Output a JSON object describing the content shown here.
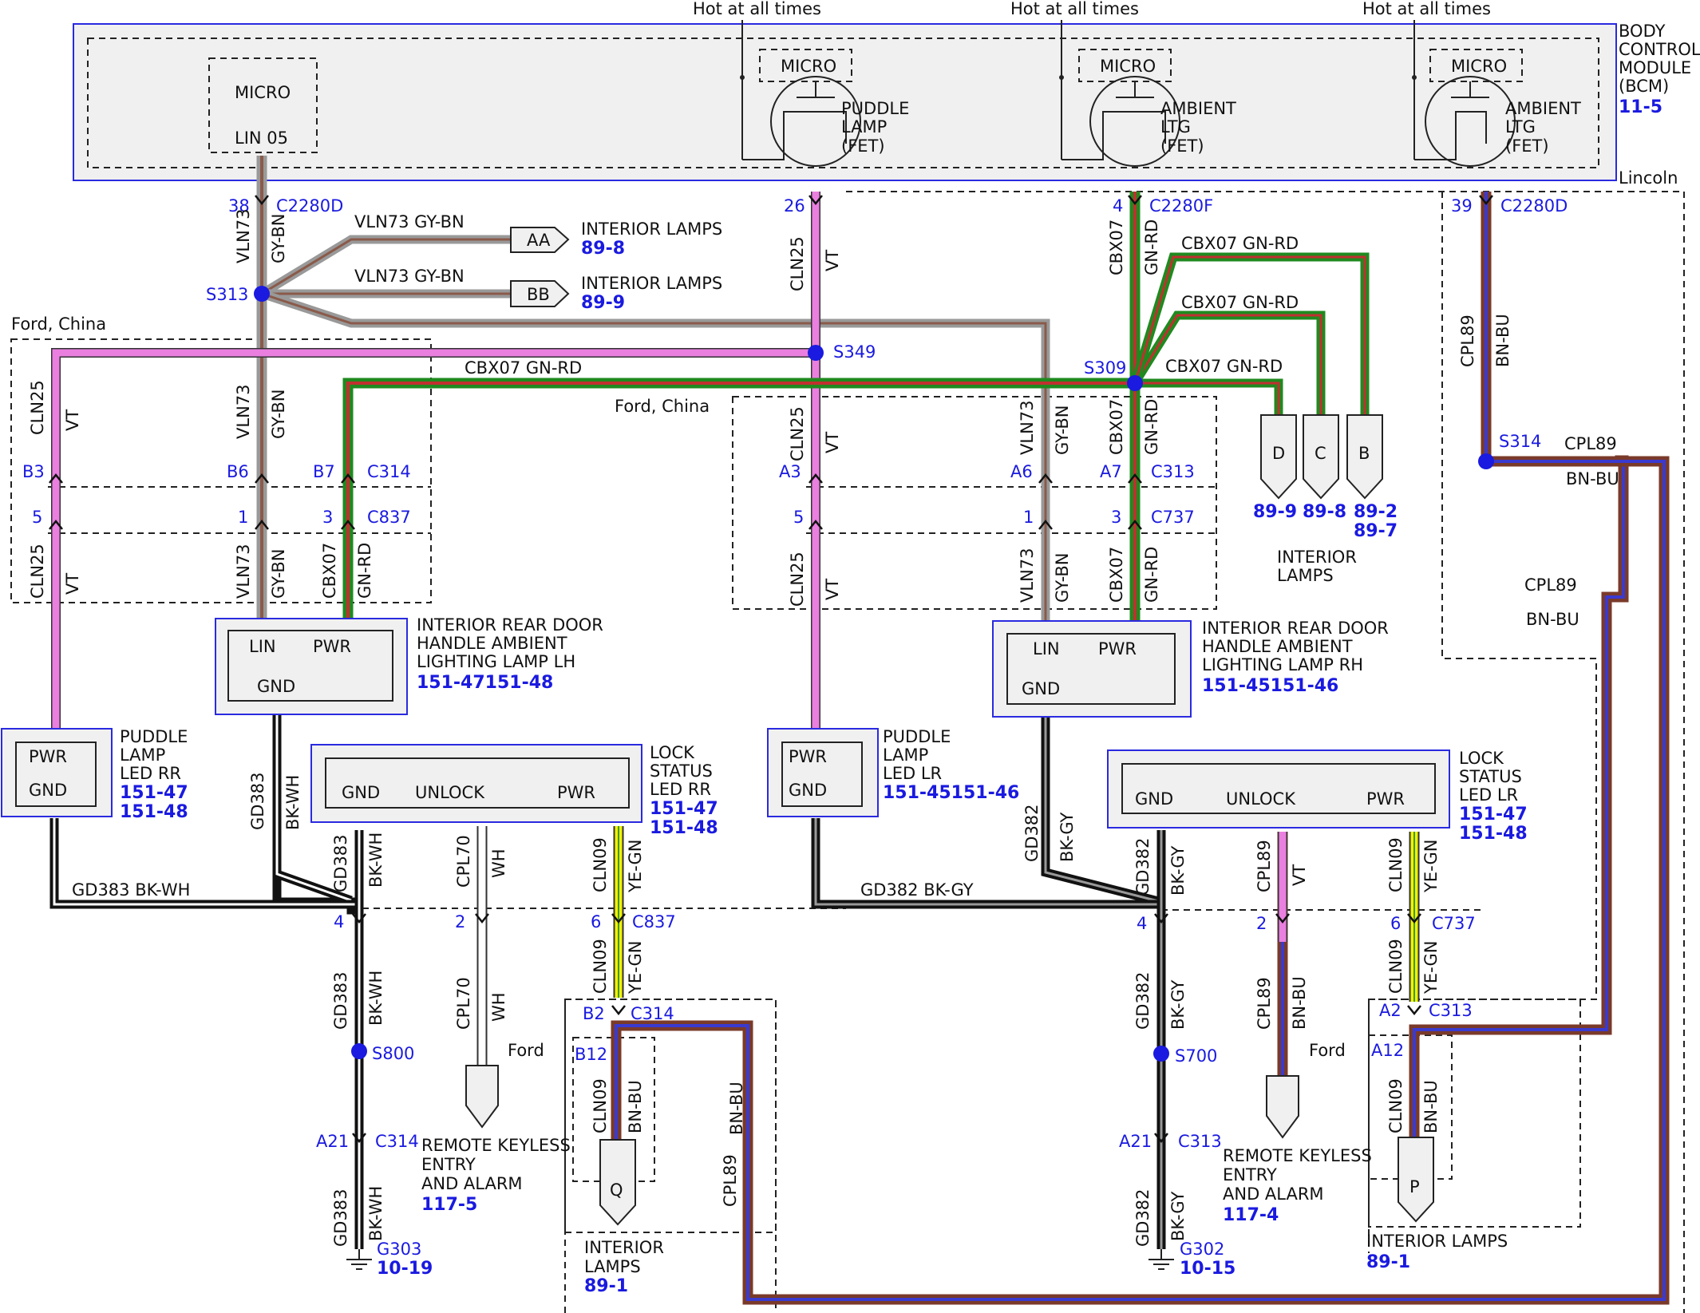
{
  "colors": {
    "blue": "#1a1ae0",
    "vt": "#ea7fe0",
    "wh": "#ffffff",
    "black": "#111111",
    "gyBn": [
      "#999999",
      "#8a5a4a"
    ],
    "gnRd": [
      "#1f8a1f",
      "#c03030"
    ],
    "bnBu": [
      "#7a3a2a",
      "#3a3ad0"
    ],
    "yeGn": [
      "#f2f200",
      "#3a9a3a"
    ]
  },
  "bcm": {
    "name": [
      "BODY",
      "CONTROL",
      "MODULE",
      "(BCM)"
    ],
    "ref": "11-5",
    "micro": "MICRO",
    "lin": "LIN 05",
    "hot": "Hot at all times",
    "lincoln": "Lincoln",
    "fets": [
      [
        "PUDDLE",
        "LAMP",
        "(FET)"
      ],
      [
        "AMBIENT",
        "LTG",
        "(FET)"
      ],
      [
        "AMBIENT",
        "LTG",
        "(FET)"
      ]
    ]
  },
  "connectors": {
    "c2280d_38": {
      "pin": "38",
      "name": "C2280D"
    },
    "c2280d_26": {
      "pin": "26"
    },
    "c2280f_4": {
      "pin": "4",
      "name": "C2280F"
    },
    "c2280d_39": {
      "pin": "39",
      "name": "C2280D"
    },
    "c314_left": [
      {
        "pin": "B3"
      },
      {
        "pin": "B6"
      },
      {
        "pin": "B7",
        "name": "C314"
      }
    ],
    "c837_left": [
      {
        "pin": "5"
      },
      {
        "pin": "1"
      },
      {
        "pin": "3",
        "name": "C837"
      }
    ],
    "c313_right": [
      {
        "pin": "A3"
      },
      {
        "pin": "A6"
      },
      {
        "pin": "A7",
        "name": "C313"
      }
    ],
    "c737_right": [
      {
        "pin": "5"
      },
      {
        "pin": "1"
      },
      {
        "pin": "3",
        "name": "C737"
      }
    ],
    "c837_low": [
      {
        "pin": "4"
      },
      {
        "pin": "2"
      },
      {
        "pin": "6",
        "name": "C837"
      }
    ],
    "c737_low": [
      {
        "pin": "4"
      },
      {
        "pin": "2"
      },
      {
        "pin": "6",
        "name": "C737"
      }
    ],
    "c314_b2": {
      "pin": "B2",
      "name": "C314"
    },
    "c313_a2": {
      "pin": "A2",
      "name": "C313"
    },
    "b12": "B12",
    "a12": "A12",
    "c314_a21": {
      "pin": "A21",
      "name": "C314"
    },
    "c313_a21": {
      "pin": "A21",
      "name": "C313"
    }
  },
  "splices": {
    "s313": "S313",
    "s349": "S349",
    "s309": "S309",
    "s314": "S314",
    "s800": "S800",
    "s700": "S700"
  },
  "regions": {
    "ford_china": "Ford, China",
    "ford": "Ford"
  },
  "wires": {
    "vln73": "VLN73",
    "gybn": "GY-BN",
    "cln25": "CLN25",
    "vt": "VT",
    "cbx07": "CBX07",
    "gnrd": "GN-RD",
    "cpl89": "CPL89",
    "bnbu": "BN-BU",
    "gd383": "GD383",
    "bkwh": "BK-WH",
    "gd382": "GD382",
    "bkgy": "BK-GY",
    "cpl70": "CPL70",
    "wh": "WH",
    "cln09": "CLN09",
    "yegn": "YE-GN",
    "gd383_h": "GD383  BK-WH",
    "gd382_h": "GD382  BK-GY",
    "vln73_h": "VLN73   GY-BN",
    "cbx07_h": "CBX07   GN-RD"
  },
  "offpage": {
    "aa": {
      "letter": "AA",
      "label": "INTERIOR LAMPS",
      "ref": "89-8"
    },
    "bb": {
      "letter": "BB",
      "label": "INTERIOR LAMPS",
      "ref": "89-9"
    },
    "d": {
      "letter": "D",
      "ref": "89-9"
    },
    "c": {
      "letter": "C",
      "ref": "89-8"
    },
    "b": {
      "letter": "B",
      "ref1": "89-2",
      "ref2": "89-7"
    },
    "int_label": [
      "INTERIOR",
      "LAMPS"
    ],
    "q": {
      "letter": "Q",
      "label": [
        "INTERIOR",
        "LAMPS"
      ],
      "ref": "89-1"
    },
    "p": {
      "letter": "P",
      "label": "INTERIOR LAMPS",
      "ref": "89-1"
    }
  },
  "components": {
    "rear_lh": {
      "lines": [
        "INTERIOR REAR DOOR",
        "HANDLE AMBIENT",
        "LIGHTING LAMP LH"
      ],
      "ref": "151-47151-48",
      "lin": "LIN",
      "pwr": "PWR",
      "gnd": "GND"
    },
    "rear_rh": {
      "lines": [
        "INTERIOR REAR DOOR",
        "HANDLE AMBIENT",
        "LIGHTING LAMP RH"
      ],
      "ref": "151-45151-46",
      "lin": "LIN",
      "pwr": "PWR",
      "gnd": "GND"
    },
    "puddle_rr": {
      "lines": [
        "PUDDLE",
        "LAMP",
        "LED RR"
      ],
      "ref1": "151-47",
      "ref2": "151-48",
      "pwr": "PWR",
      "gnd": "GND"
    },
    "puddle_lr": {
      "lines": [
        "PUDDLE",
        "LAMP",
        "LED LR"
      ],
      "ref": "151-45151-46",
      "pwr": "PWR",
      "gnd": "GND"
    },
    "lock_rr": {
      "lines": [
        "LOCK",
        "STATUS",
        "LED RR"
      ],
      "ref1": "151-47",
      "ref2": "151-48",
      "gnd": "GND",
      "unlock": "UNLOCK",
      "pwr": "PWR"
    },
    "lock_lr": {
      "lines": [
        "LOCK",
        "STATUS",
        "LED LR"
      ],
      "ref1": "151-47",
      "ref2": "151-48",
      "gnd": "GND",
      "unlock": "UNLOCK",
      "pwr": "PWR"
    },
    "rke_l": {
      "lines": [
        "REMOTE KEYLESS",
        "ENTRY",
        "AND ALARM"
      ],
      "ref": "117-5"
    },
    "rke_r": {
      "lines": [
        "REMOTE KEYLESS",
        "ENTRY",
        "AND ALARM"
      ],
      "ref": "117-4"
    }
  },
  "grounds": {
    "g303": {
      "name": "G303",
      "ref": "10-19"
    },
    "g302": {
      "name": "G302",
      "ref": "10-15"
    }
  }
}
